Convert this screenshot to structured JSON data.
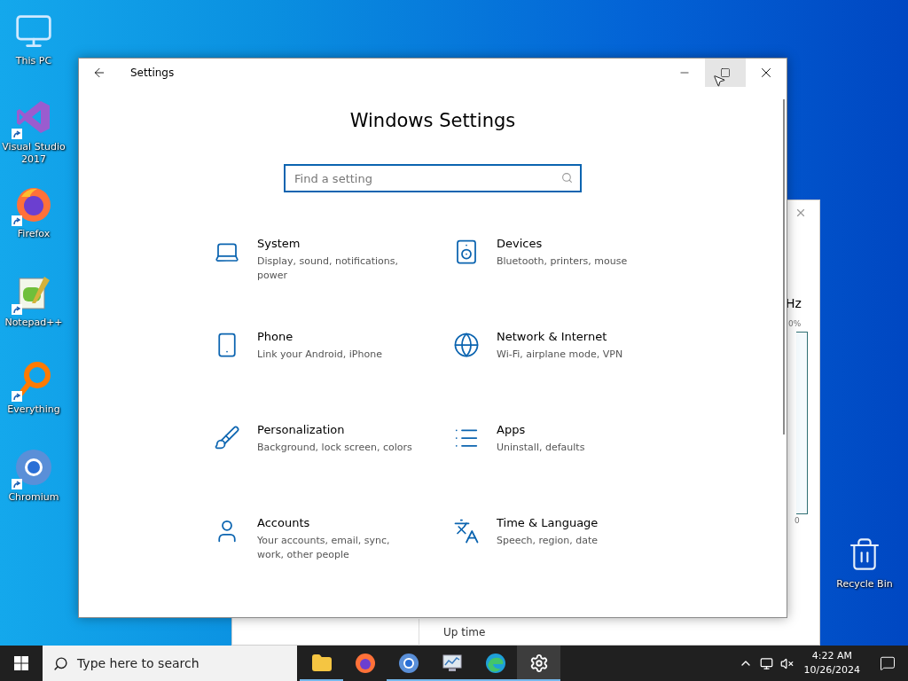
{
  "desktop_icons": [
    {
      "label": "This PC",
      "kind": "pc",
      "shortcut": false
    },
    {
      "label": "Visual Studio 2017",
      "kind": "vs",
      "shortcut": true
    },
    {
      "label": "Firefox",
      "kind": "firefox",
      "shortcut": true
    },
    {
      "label": "Notepad++",
      "kind": "notepad",
      "shortcut": true
    },
    {
      "label": "Everything",
      "kind": "everything",
      "shortcut": true
    },
    {
      "label": "Chromium",
      "kind": "chromium",
      "shortcut": true
    }
  ],
  "recycle_bin": {
    "label": "Recycle Bin"
  },
  "background_window": {
    "unit_label": "Hz",
    "percent_label": "0%",
    "axis_label": "0",
    "uptime_label": "Up time"
  },
  "settings_window": {
    "title": "Settings",
    "heading": "Windows Settings",
    "search": {
      "placeholder": "Find a setting"
    },
    "categories": [
      {
        "kind": "system",
        "title": "System",
        "description": "Display, sound, notifications, power"
      },
      {
        "kind": "devices",
        "title": "Devices",
        "description": "Bluetooth, printers, mouse"
      },
      {
        "kind": "phone",
        "title": "Phone",
        "description": "Link your Android, iPhone"
      },
      {
        "kind": "network",
        "title": "Network & Internet",
        "description": "Wi-Fi, airplane mode, VPN"
      },
      {
        "kind": "personalization",
        "title": "Personalization",
        "description": "Background, lock screen, colors"
      },
      {
        "kind": "apps",
        "title": "Apps",
        "description": "Uninstall, defaults"
      },
      {
        "kind": "accounts",
        "title": "Accounts",
        "description": "Your accounts, email, sync, work, other people"
      },
      {
        "kind": "time",
        "title": "Time & Language",
        "description": "Speech, region, date"
      }
    ]
  },
  "taskbar": {
    "search_placeholder": "Type here to search",
    "apps": [
      {
        "kind": "explorer",
        "running": true,
        "selected": false
      },
      {
        "kind": "firefox",
        "running": false,
        "selected": false
      },
      {
        "kind": "chromium",
        "running": true,
        "selected": false
      },
      {
        "kind": "taskmgr",
        "running": true,
        "selected": false
      },
      {
        "kind": "edge",
        "running": true,
        "selected": false
      },
      {
        "kind": "settings",
        "running": true,
        "selected": true
      }
    ],
    "time": "4:22 AM",
    "date": "10/26/2024"
  }
}
